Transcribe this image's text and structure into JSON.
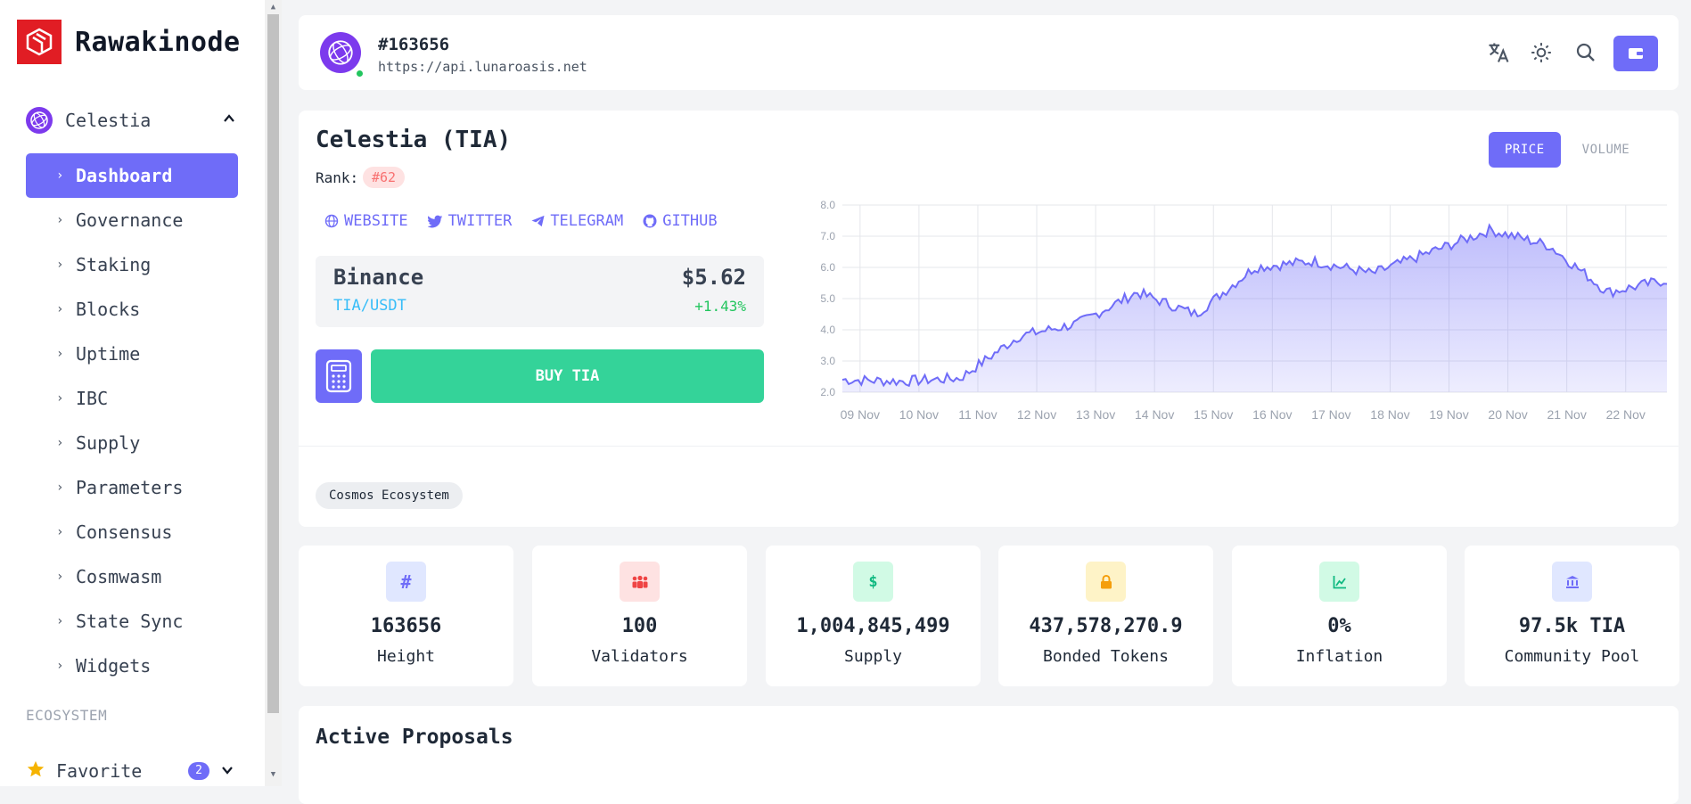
{
  "brand": {
    "name": "Rawakinode"
  },
  "chain": {
    "name": "Celestia"
  },
  "nav": {
    "items": [
      {
        "label": "Dashboard",
        "active": true
      },
      {
        "label": "Governance"
      },
      {
        "label": "Staking"
      },
      {
        "label": "Blocks"
      },
      {
        "label": "Uptime"
      },
      {
        "label": "IBC"
      },
      {
        "label": "Supply"
      },
      {
        "label": "Parameters"
      },
      {
        "label": "Consensus"
      },
      {
        "label": "Cosmwasm"
      },
      {
        "label": "State Sync"
      },
      {
        "label": "Widgets"
      }
    ],
    "section_label": "ECOSYSTEM",
    "favorite": {
      "label": "Favorite",
      "count": "2"
    }
  },
  "header": {
    "height": "#163656",
    "endpoint": "https://api.lunaroasis.net",
    "icons": [
      "translate-icon",
      "theme-icon",
      "search-icon",
      "wallet-icon"
    ]
  },
  "market": {
    "title": "Celestia (TIA)",
    "rank_label": "Rank:",
    "rank": "#62",
    "links": [
      {
        "label": "WEBSITE",
        "icon": "globe-icon"
      },
      {
        "label": "TWITTER",
        "icon": "twitter-icon"
      },
      {
        "label": "TELEGRAM",
        "icon": "telegram-icon"
      },
      {
        "label": "GITHUB",
        "icon": "github-icon"
      }
    ],
    "ticker": {
      "exchange": "Binance",
      "pair": "TIA/USDT",
      "price": "$5.62",
      "change": "+1.43%"
    },
    "buy_label": "BUY TIA",
    "chart_tabs": {
      "price": "PRICE",
      "volume": "VOLUME"
    },
    "tag": "Cosmos Ecosystem"
  },
  "chart_data": {
    "type": "area",
    "x": [
      "09 Nov",
      "10 Nov",
      "11 Nov",
      "12 Nov",
      "13 Nov",
      "14 Nov",
      "15 Nov",
      "16 Nov",
      "17 Nov",
      "18 Nov",
      "19 Nov",
      "20 Nov",
      "21 Nov",
      "22 Nov",
      "22 Nov+"
    ],
    "y": [
      2.4,
      2.35,
      2.45,
      3.8,
      4.2,
      5.2,
      4.5,
      6.0,
      6.2,
      5.8,
      6.5,
      7.2,
      6.7,
      5.2,
      5.6
    ],
    "xticks": [
      "09 Nov",
      "10 Nov",
      "11 Nov",
      "12 Nov",
      "13 Nov",
      "14 Nov",
      "15 Nov",
      "16 Nov",
      "17 Nov",
      "18 Nov",
      "19 Nov",
      "20 Nov",
      "21 Nov",
      "22 Nov"
    ],
    "yticks": [
      "2.0",
      "3.0",
      "4.0",
      "5.0",
      "6.0",
      "7.0",
      "8.0"
    ],
    "ylim": [
      2.0,
      8.0
    ],
    "color": "#6f6cf8",
    "grid": true
  },
  "stats": [
    {
      "value": "163656",
      "label": "Height",
      "icon": "#",
      "bg": "#e0e7ff",
      "fg": "#6f6cf8"
    },
    {
      "value": "100",
      "label": "Validators",
      "icon": "users-icon",
      "bg": "#fee2e2",
      "fg": "#ef4444"
    },
    {
      "value": "1,004,845,499",
      "label": "Supply",
      "icon": "$",
      "bg": "#d1fae5",
      "fg": "#10b981"
    },
    {
      "value": "437,578,270.9",
      "label": "Bonded Tokens",
      "icon": "lock-icon",
      "bg": "#fef3c7",
      "fg": "#f59e0b"
    },
    {
      "value": "0%",
      "label": "Inflation",
      "icon": "chart-icon",
      "bg": "#d1fae5",
      "fg": "#10b981"
    },
    {
      "value": "97.5k TIA",
      "label": "Community Pool",
      "icon": "bank-icon",
      "bg": "#e0e7ff",
      "fg": "#6f6cf8"
    }
  ],
  "proposals": {
    "title": "Active Proposals"
  }
}
